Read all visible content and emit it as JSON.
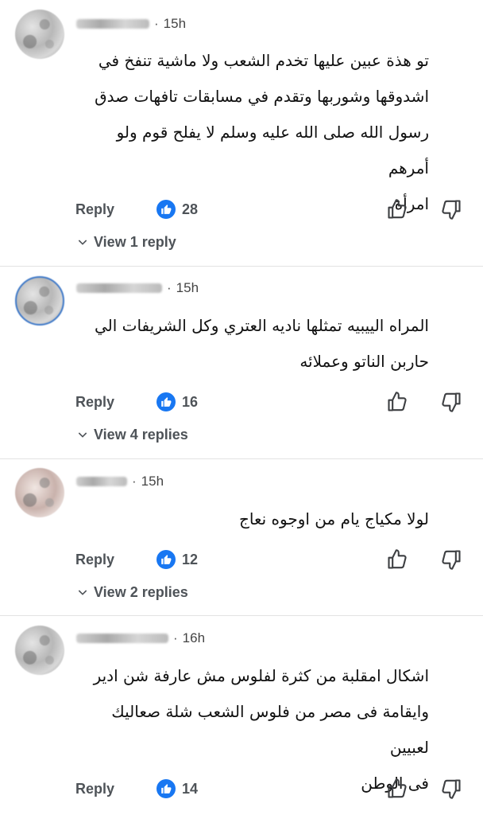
{
  "comments": [
    {
      "time": "15h",
      "lines": [
        "تو هذة عبين عليها تخدم الشعب ولا ماشية تنفخ في",
        "اشدوقها وشوربها وتقدم في مسابقات تافهات صدق",
        "رسول الله صلى الله عليه وسلم لا يفلح قوم ولو أمرهم",
        "امرأة"
      ],
      "reply_label": "Reply",
      "likes": "28",
      "view_replies": "View 1 reply"
    },
    {
      "time": "15h",
      "lines": [
        "المراه الييبيه تمثلها ناديه العتري وكل الشريفات الي",
        "حاربن الناتو وعملائه"
      ],
      "reply_label": "Reply",
      "likes": "16",
      "view_replies": "View 4 replies"
    },
    {
      "time": "15h",
      "lines": [
        "لولا مكياج يام من اوجوه نعاج"
      ],
      "reply_label": "Reply",
      "likes": "12",
      "view_replies": "View 2 replies"
    },
    {
      "time": "16h",
      "lines": [
        "اشكال امقلبة من كثرة لفلوس مش عارفة شن ادير",
        "وايقامة فى مصر من فلوس الشعب شلة صعاليك لعبيين",
        "فى الوطن"
      ],
      "reply_label": "Reply",
      "likes": "14",
      "view_replies": ""
    }
  ],
  "icons": {
    "like_badge": "like-badge-icon",
    "thumb_up": "thumbs-up-icon",
    "thumb_down": "thumbs-down-icon",
    "chevron": "chevron-down-icon"
  },
  "colors": {
    "like_badge": "#1877f2",
    "action_text": "#4e5358"
  }
}
